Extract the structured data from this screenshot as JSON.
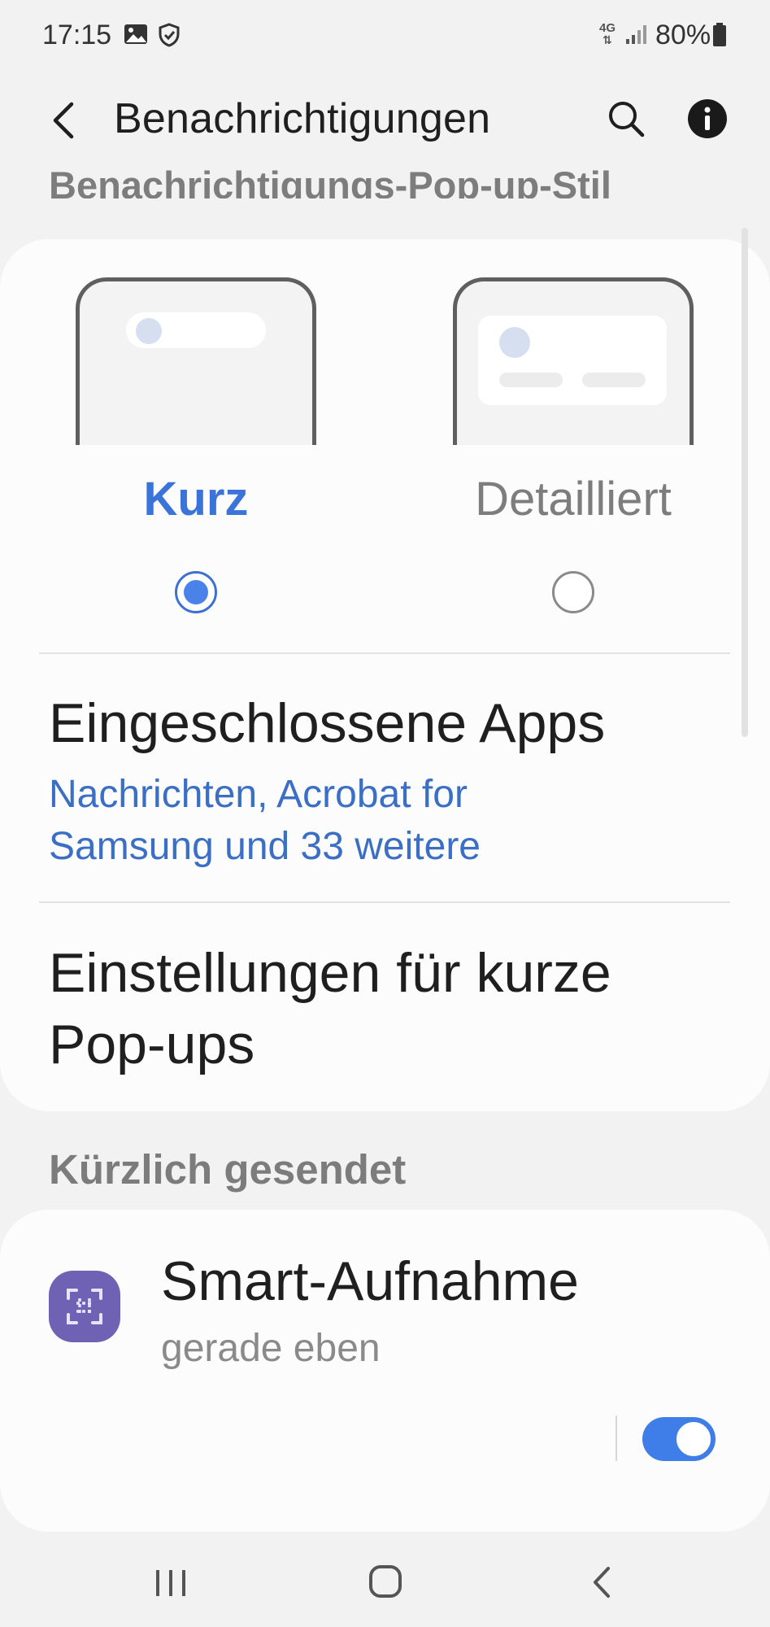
{
  "status_bar": {
    "time": "17:15",
    "network": "4G",
    "battery": "80%"
  },
  "app_bar": {
    "title": "Benachrichtigungen"
  },
  "popup_style_section": {
    "header": "Benachrichtigungs-Pop-up-Stil",
    "options": [
      {
        "label": "Kurz",
        "selected": true,
        "color": "#3a74d8"
      },
      {
        "label": "Detailliert",
        "selected": false,
        "color": "#7d7d7d"
      }
    ]
  },
  "included_apps": {
    "title": "Eingeschlossene Apps",
    "subtitle": "Nachrichten, Acrobat for Samsung und 33 weitere"
  },
  "brief_popup_settings": {
    "title": "Einstellungen für kurze Pop-ups"
  },
  "recently_sent": {
    "header": "Kürzlich gesendet",
    "items": [
      {
        "app": "Smart-Aufnahme",
        "time": "gerade eben",
        "enabled": true,
        "icon": "smart-capture-icon"
      }
    ]
  },
  "colors": {
    "accent": "#3f7ee8",
    "background": "#f2f2f2",
    "card": "#fcfcfc"
  }
}
